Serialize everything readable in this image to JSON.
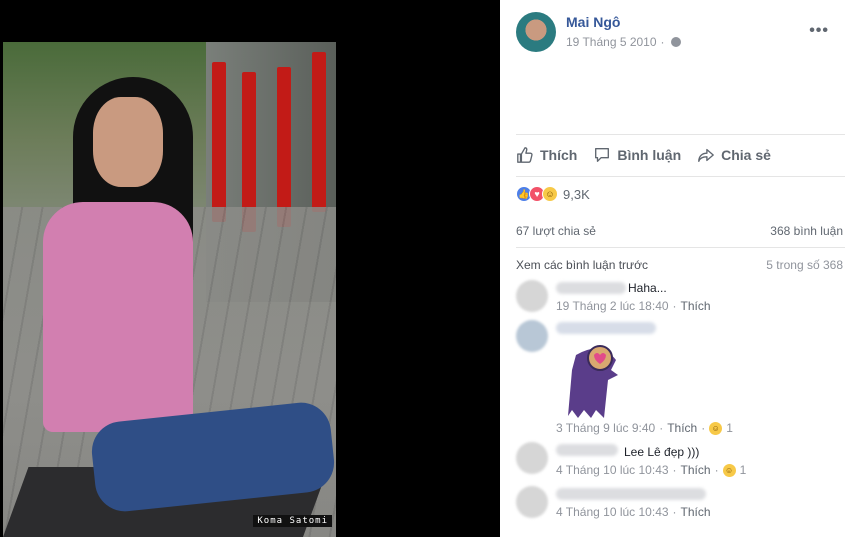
{
  "photo": {
    "watermark": "Koma Satomi"
  },
  "post": {
    "author": "Mai Ngô",
    "date": "19 Tháng 5 2010",
    "separator": "·",
    "more_label": "•••"
  },
  "actions": {
    "like": "Thích",
    "comment": "Bình luận",
    "share": "Chia sẻ"
  },
  "reactions": {
    "count": "9,3K"
  },
  "stats": {
    "shares": "67 lượt chia sẻ",
    "comments": "368 bình luận"
  },
  "comments_header": {
    "view_previous": "Xem các bình luận trước",
    "count": "5 trong số 368"
  },
  "comments": [
    {
      "text": "Haha...",
      "time": "19 Tháng 2 lúc 18:40",
      "like": "Thích",
      "reactions": ""
    },
    {
      "text": "",
      "time": "3 Tháng 9 lúc 9:40",
      "like": "Thích",
      "reactions": "1"
    },
    {
      "text": "Lee Lê đẹp        )))",
      "time": "4 Tháng 10 lúc 10:43",
      "like": "Thích",
      "reactions": "1"
    },
    {
      "text": "",
      "time": "4 Tháng 10 lúc 10:43",
      "like": "Thích",
      "reactions": ""
    }
  ],
  "colors": {
    "link": "#365899",
    "meta": "#90949c",
    "text": "#1d2129",
    "like_reaction": "#4d7fe8",
    "love_reaction": "#f25268",
    "haha_reaction": "#f7c948"
  }
}
